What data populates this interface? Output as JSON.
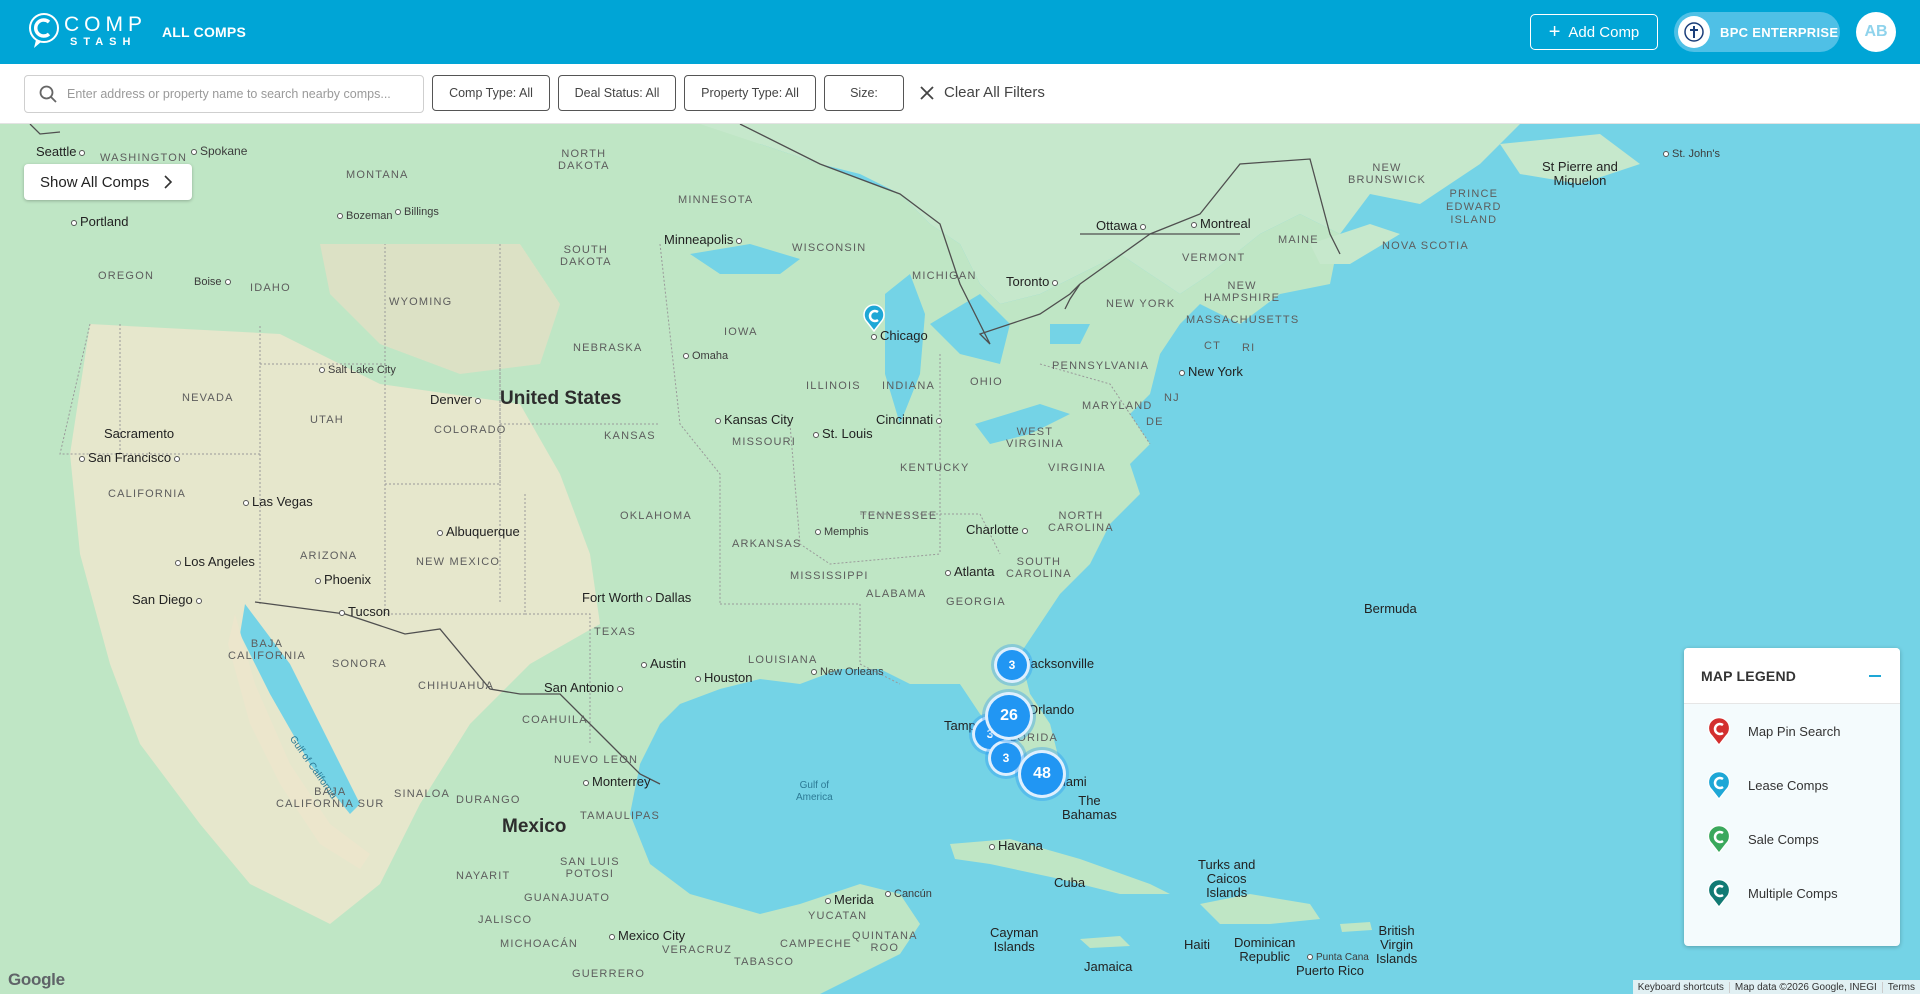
{
  "header": {
    "logo_top": "COMP",
    "logo_bottom": "STASH",
    "nav_label": "ALL COMPS",
    "add_button": "Add Comp",
    "enterprise_label": "BPC ENTERPRISE",
    "avatar_initials": "AB"
  },
  "filters": {
    "search_placeholder": "Enter address or property name to search nearby comps...",
    "comp_type": "Comp Type: All",
    "deal_status": "Deal Status: All",
    "property_type": "Property Type: All",
    "size": "Size:",
    "clear": "Clear All Filters"
  },
  "map": {
    "show_all": "Show All Comps",
    "countries": {
      "us": "United States",
      "mexico": "Mexico"
    },
    "clusters": [
      {
        "count": "3"
      },
      {
        "count": "26"
      },
      {
        "count": "3"
      },
      {
        "count": "3"
      },
      {
        "count": "48"
      }
    ],
    "states": {
      "washington": "WASHINGTON",
      "montana": "MONTANA",
      "north_dakota": "NORTH\nDAKOTA",
      "minnesota": "MINNESOTA",
      "oregon": "OREGON",
      "idaho": "IDAHO",
      "wyoming": "WYOMING",
      "south_dakota": "SOUTH\nDAKOTA",
      "wisconsin": "WISCONSIN",
      "michigan": "MICHIGAN",
      "iowa": "IOWA",
      "nebraska": "NEBRASKA",
      "nevada": "NEVADA",
      "utah": "UTAH",
      "colorado": "COLORADO",
      "kansas": "KANSAS",
      "illinois": "ILLINOIS",
      "indiana": "INDIANA",
      "ohio": "OHIO",
      "missouri": "MISSOURI",
      "california": "CALIFORNIA",
      "arizona": "ARIZONA",
      "new_mexico": "NEW MEXICO",
      "oklahoma": "OKLAHOMA",
      "arkansas": "ARKANSAS",
      "tennessee": "TENNESSEE",
      "kentucky": "KENTUCKY",
      "west_virginia": "WEST\nVIRGINIA",
      "virginia": "VIRGINIA",
      "north_carolina": "NORTH\nCAROLINA",
      "south_carolina": "SOUTH\nCAROLINA",
      "mississippi": "MISSISSIPPI",
      "alabama": "ALABAMA",
      "georgia": "GEORGIA",
      "texas": "TEXAS",
      "louisiana": "LOUISIANA",
      "florida": "FLORIDA",
      "pennsylvania": "PENNSYLVANIA",
      "new_york": "NEW YORK",
      "vermont": "VERMONT",
      "new_hampshire": "NEW\nHAMPSHIRE",
      "maine": "MAINE",
      "massachusetts": "MASSACHUSETTS",
      "maryland": "MARYLAND",
      "ct": "CT",
      "ri": "RI",
      "nj": "NJ",
      "de": "DE",
      "new_brunswick": "NEW\nBRUNSWICK",
      "pei": "PRINCE\nEDWARD\nISLAND",
      "nova_scotia": "NOVA SCOTIA",
      "baja_california": "BAJA\nCALIFORNIA",
      "baja_california_sur": "BAJA\nCALIFORNIA SUR",
      "sonora": "SONORA",
      "chihuahua": "CHIHUAHUA",
      "coahuila": "COAHUILA",
      "nuevo_leon": "NUEVO LEON",
      "sinaloa": "SINALOA",
      "durango": "DURANGO",
      "tamaulipas": "TAMAULIPAS",
      "san_luis_potosi": "SAN LUIS\nPOTOSI",
      "nayarit": "NAYARIT",
      "guanajuato": "GUANAJUATO",
      "jalisco": "JALISCO",
      "michoacan": "MICHOACÁN",
      "veracruz": "VERACRUZ",
      "guerrero": "GUERRERO",
      "yucatan": "YUCATAN",
      "campeche": "CAMPECHE",
      "quintana_roo": "QUINTANA\nROO",
      "tabasco": "TABASCO"
    },
    "cities": {
      "seattle": "Seattle",
      "spokane": "Spokane",
      "portland": "Portland",
      "bozeman": "Bozeman",
      "billings": "Billings",
      "boise": "Boise",
      "minneapolis": "Minneapolis",
      "chicago": "Chicago",
      "toronto": "Toronto",
      "ottawa": "Ottawa",
      "montreal": "Montreal",
      "new_york": "New York",
      "salt_lake": "Salt Lake City",
      "denver": "Denver",
      "omaha": "Omaha",
      "kansas_city": "Kansas City",
      "st_louis": "St. Louis",
      "cincinnati": "Cincinnati",
      "sacramento": "Sacramento",
      "san_francisco": "San Francisco",
      "las_vegas": "Las Vegas",
      "albuquerque": "Albuquerque",
      "memphis": "Memphis",
      "charlotte": "Charlotte",
      "los_angeles": "Los Angeles",
      "phoenix": "Phoenix",
      "atlanta": "Atlanta",
      "san_diego": "San Diego",
      "tucson": "Tucson",
      "fort_worth": "Fort Worth",
      "dallas": "Dallas",
      "jacksonville": "Jacksonville",
      "austin": "Austin",
      "houston": "Houston",
      "new_orleans": "New Orleans",
      "san_antonio": "San Antonio",
      "orlando": "Orlando",
      "tampa": "Tampa",
      "miami": "Miami",
      "monterrey": "Monterrey",
      "havana": "Havana",
      "merida": "Merida",
      "cancun": "Cancún",
      "mexico_city": "Mexico City",
      "st_johns": "St. John's",
      "punta_cana": "Punta Cana"
    },
    "regions": {
      "st_pierre": "St Pierre and\nMiquelon",
      "bermuda": "Bermuda",
      "bahamas": "The\nBahamas",
      "cuba": "Cuba",
      "turks": "Turks and\nCaicos\nIslands",
      "cayman": "Cayman\nIslands",
      "haiti": "Haiti",
      "dominican": "Dominican\nRepublic",
      "puerto_rico": "Puerto Rico",
      "bvi": "British\nVirgin\nIslands",
      "jamaica": "Jamaica",
      "gulf_california": "Gulf of California",
      "gulf_america": "Gulf of\nAmerica"
    },
    "legend": {
      "title": "MAP LEGEND",
      "items": [
        {
          "label": "Map Pin Search",
          "color": "#d32f2f"
        },
        {
          "label": "Lease Comps",
          "color": "#1ea7d6"
        },
        {
          "label": "Sale Comps",
          "color": "#3aa85c"
        },
        {
          "label": "Multiple Comps",
          "color": "#127a74"
        }
      ]
    },
    "google_logo": "Google",
    "attribution": [
      "Keyboard shortcuts",
      "Map data ©2026 Google, INEGI",
      "Terms"
    ]
  },
  "colors": {
    "header_bg": "#00a5d6",
    "water": "#74d3e6",
    "land": "#bfe6c5",
    "desert": "#ede6cf",
    "cluster": "#2196f3"
  }
}
